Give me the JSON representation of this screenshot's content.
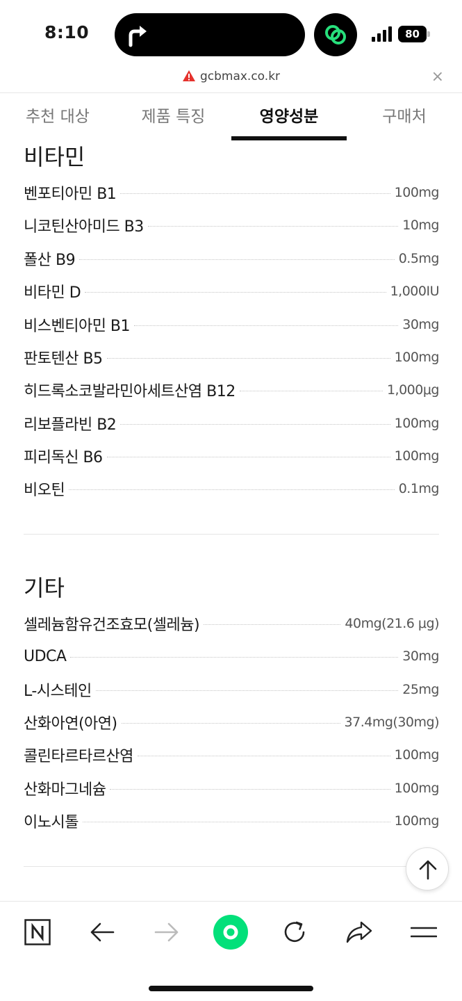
{
  "status_bar": {
    "time": "8:10",
    "battery": "80"
  },
  "url_bar": {
    "domain": "gcbmax.co.kr",
    "close": "×"
  },
  "tabs": [
    {
      "label": "추천 대상"
    },
    {
      "label": "제품 특징"
    },
    {
      "label": "영양성분"
    },
    {
      "label": "구매처"
    }
  ],
  "active_tab": "영양성분",
  "sections": [
    {
      "title": "비타민",
      "items": [
        {
          "name": "벤포티아민 B1",
          "amount": "100mg"
        },
        {
          "name": "니코틴산아미드 B3",
          "amount": "10mg"
        },
        {
          "name": "폴산 B9",
          "amount": "0.5mg"
        },
        {
          "name": "비타민 D",
          "amount": "1,000IU"
        },
        {
          "name": "비스벤티아민 B1",
          "amount": "30mg"
        },
        {
          "name": "판토텐산 B5",
          "amount": "100mg"
        },
        {
          "name": "히드록소코발라민아세트산염 B12",
          "amount": "1,000μg"
        },
        {
          "name": "리보플라빈 B2",
          "amount": "100mg"
        },
        {
          "name": "피리독신 B6",
          "amount": "100mg"
        },
        {
          "name": "비오틴",
          "amount": "0.1mg"
        }
      ]
    },
    {
      "title": "기타",
      "items": [
        {
          "name": "셀레늄함유건조효모(셀레늄)",
          "amount": "40mg(21.6 μg)"
        },
        {
          "name": "UDCA",
          "amount": "30mg"
        },
        {
          "name": "L-시스테인",
          "amount": "25mg"
        },
        {
          "name": "산화아연(아연)",
          "amount": "37.4mg(30mg)"
        },
        {
          "name": "콜린타르타르산염",
          "amount": "100mg"
        },
        {
          "name": "산화마그네슘",
          "amount": "100mg"
        },
        {
          "name": "이노시톨",
          "amount": "100mg"
        }
      ]
    }
  ],
  "colors": {
    "accent_green": "#03e07a",
    "text": "#1a1a1a",
    "warning": "#e5322d"
  },
  "toolbar_icons": [
    "naver-n-icon",
    "back-arrow-icon",
    "forward-arrow-icon",
    "green-dot-icon",
    "refresh-icon",
    "share-icon",
    "menu-icon"
  ]
}
